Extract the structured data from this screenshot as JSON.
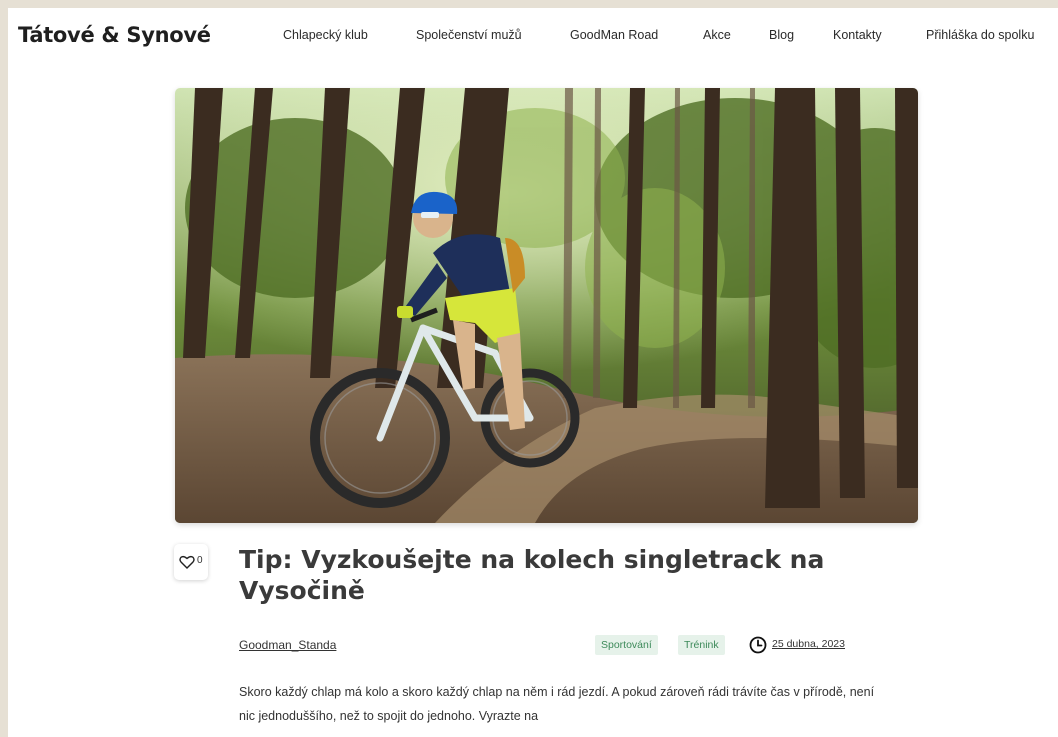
{
  "site": {
    "logo": "Tátové & Synové"
  },
  "nav": {
    "items": [
      {
        "label": "Chlapecký klub"
      },
      {
        "label": "Společenství mužů"
      },
      {
        "label": "GoodMan Road"
      },
      {
        "label": "Akce"
      },
      {
        "label": "Blog"
      },
      {
        "label": "Kontakty"
      },
      {
        "label": "Přihláška do spolku"
      }
    ]
  },
  "post": {
    "likes": "0",
    "title": "Tip: Vyzkoušejte na kolech singletrack na Vysočině",
    "author": "Goodman_Standa",
    "tags": [
      {
        "label": "Sportování"
      },
      {
        "label": "Trénink"
      }
    ],
    "date": "25 dubna, 2023",
    "excerpt": "Skoro každý chlap má kolo a skoro každý chlap na něm i rád jezdí. A pokud zároveň rádi trávíte čas v přírodě, není nic jednoduššího, než to spojit do jednoho. Vyrazte na"
  },
  "colors": {
    "page_background": "#e6e0d4",
    "tag_text": "#3d8a5a",
    "tag_background": "#e6f2ea",
    "title_text": "#3a3a3a"
  },
  "icons": {
    "like": "heart-icon",
    "date": "clock-icon"
  }
}
